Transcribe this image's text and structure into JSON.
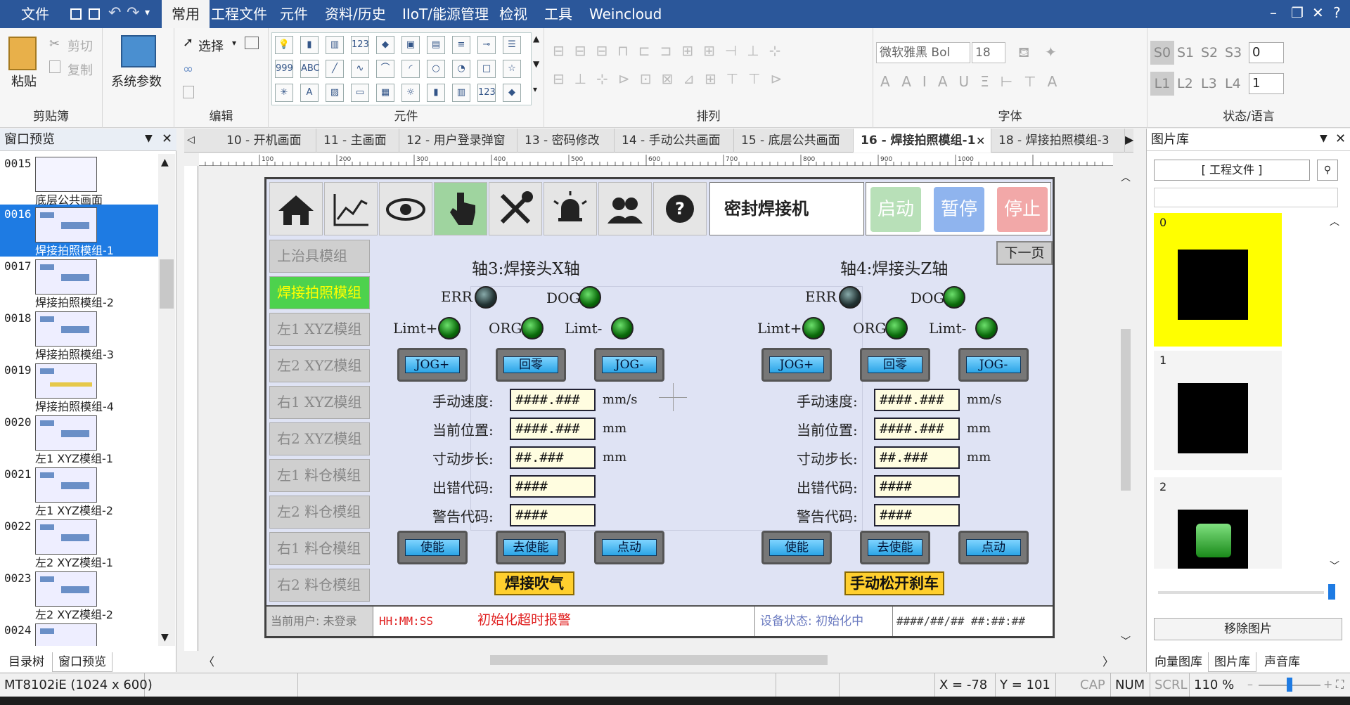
{
  "menu": {
    "file": "文件",
    "tabs": [
      "常用",
      "工程文件",
      "元件",
      "资料/历史",
      "IIoT/能源管理",
      "检视",
      "工具",
      "Weincloud"
    ],
    "active_tab": "常用",
    "window_controls": [
      "–",
      "❐",
      "✕",
      "?"
    ]
  },
  "ribbon": {
    "clipboard": {
      "paste": "粘贴",
      "cut": "剪切",
      "copy": "复制",
      "group": "剪贴簿"
    },
    "edit": {
      "select": "选择",
      "group": "编辑"
    },
    "system": {
      "label": "系统参数"
    },
    "elements": {
      "group": "元件"
    },
    "arrange": {
      "group": "排列"
    },
    "font": {
      "family": "微软雅黑 Bol",
      "size": "18",
      "group": "字体"
    },
    "state": {
      "s_tabs": [
        "S0",
        "S1",
        "S2",
        "S3"
      ],
      "s_value": "0",
      "l_tabs": [
        "L1",
        "L2",
        "L3",
        "L4"
      ],
      "l_value": "1",
      "group": "状态/语言"
    }
  },
  "left_panel": {
    "title": "窗口预览",
    "items": [
      {
        "num": "0015",
        "label": "底层公共画面"
      },
      {
        "num": "0016",
        "label": "焊接拍照模组-1",
        "selected": true
      },
      {
        "num": "0017",
        "label": "焊接拍照模组-2"
      },
      {
        "num": "0018",
        "label": "焊接拍照模组-3"
      },
      {
        "num": "0019",
        "label": "焊接拍照模组-4"
      },
      {
        "num": "0020",
        "label": "左1 XYZ模组-1"
      },
      {
        "num": "0021",
        "label": "左1 XYZ模组-2"
      },
      {
        "num": "0022",
        "label": "左2 XYZ模组-1"
      },
      {
        "num": "0023",
        "label": "左2 XYZ模组-2"
      },
      {
        "num": "0024",
        "label": ""
      }
    ],
    "bottom_tabs": [
      "目录树",
      "窗口预览"
    ],
    "active_bottom_tab": "窗口预览"
  },
  "doc_tabs": [
    "10 - 开机画面",
    "11 - 主画面",
    "12 - 用户登录弹窗",
    "13 - 密码修改",
    "14 - 手动公共画面",
    "15 - 底层公共画面",
    "16 - 焊接拍照模组-1",
    "18 - 焊接拍照模组-3"
  ],
  "active_doc_tab": "16 - 焊接拍照模组-1",
  "ruler_labels": [
    "100",
    "200",
    "300",
    "400",
    "500",
    "600",
    "700",
    "800",
    "900",
    "1000"
  ],
  "hmi": {
    "machine_title": "密封焊接机",
    "start": "启动",
    "pause": "暂停",
    "stop": "停止",
    "next_page": "下一页",
    "modules": [
      "上治具模组",
      "焊接拍照模组",
      "左1 XYZ模组",
      "左2 XYZ模组",
      "右1 XYZ模组",
      "右2 XYZ模组",
      "左1 料仓模组",
      "左2 料仓模组",
      "右1 料仓模组",
      "右2 料仓模组"
    ],
    "active_module": "焊接拍照模组",
    "axes": [
      {
        "title": "轴3:焊接头X轴",
        "err": "ERR",
        "dog": "DOG",
        "limit_plus": "Limt+",
        "org": "ORG",
        "limit_minus": "Limt-",
        "jog_plus": "JOG+",
        "home": "回零",
        "jog_minus": "JOG-",
        "speed_label": "手动速度:",
        "speed_value": "####.###",
        "speed_unit": "mm/s",
        "pos_label": "当前位置:",
        "pos_value": "####.###",
        "pos_unit": "mm",
        "step_label": "寸动步长:",
        "step_value": "##.###",
        "step_unit": "mm",
        "err_code_label": "出错代码:",
        "err_code_value": "####",
        "warn_code_label": "警告代码:",
        "warn_code_value": "####",
        "enable": "使能",
        "disable": "去使能",
        "inch": "点动",
        "extra": "焊接吹气"
      },
      {
        "title": "轴4:焊接头Z轴",
        "err": "ERR",
        "dog": "DOG",
        "limit_plus": "Limt+",
        "org": "ORG",
        "limit_minus": "Limt-",
        "jog_plus": "JOG+",
        "home": "回零",
        "jog_minus": "JOG-",
        "speed_label": "手动速度:",
        "speed_value": "####.###",
        "speed_unit": "mm/s",
        "pos_label": "当前位置:",
        "pos_value": "####.###",
        "pos_unit": "mm",
        "step_label": "寸动步长:",
        "step_value": "##.###",
        "step_unit": "mm",
        "err_code_label": "出错代码:",
        "err_code_value": "####",
        "warn_code_label": "警告代码:",
        "warn_code_value": "####",
        "enable": "使能",
        "disable": "去使能",
        "inch": "点动",
        "extra": "手动松开刹车"
      }
    ],
    "footer": {
      "user": "当前用户: 未登录",
      "time": "HH:MM:SS",
      "alarm": "初始化超时报警",
      "device_status": "设备状态: 初始化中",
      "datetime": "####/##/## ##:##:##"
    }
  },
  "right_panel": {
    "title": "图片库",
    "dropdown": "[ 工程文件 ]",
    "items": [
      "0",
      "1",
      "2"
    ],
    "remove": "移除图片",
    "bottom_tabs": [
      "向量图库",
      "图片库",
      "声音库"
    ],
    "active_bottom_tab": "图片库"
  },
  "status": {
    "model": "MT8102iE (1024 x 600)",
    "x": "X = -78",
    "y": "Y = 101",
    "cap": "CAP",
    "num": "NUM",
    "scrl": "SCRL",
    "zoom": "110 %"
  },
  "colors": {
    "menubar": "#2b579a",
    "selected": "#1e7be3",
    "hmi_bg": "#dfe3f4",
    "active_module": "#4dd24d",
    "yellow": "#ffcf2e",
    "alarm": "#e02020"
  }
}
